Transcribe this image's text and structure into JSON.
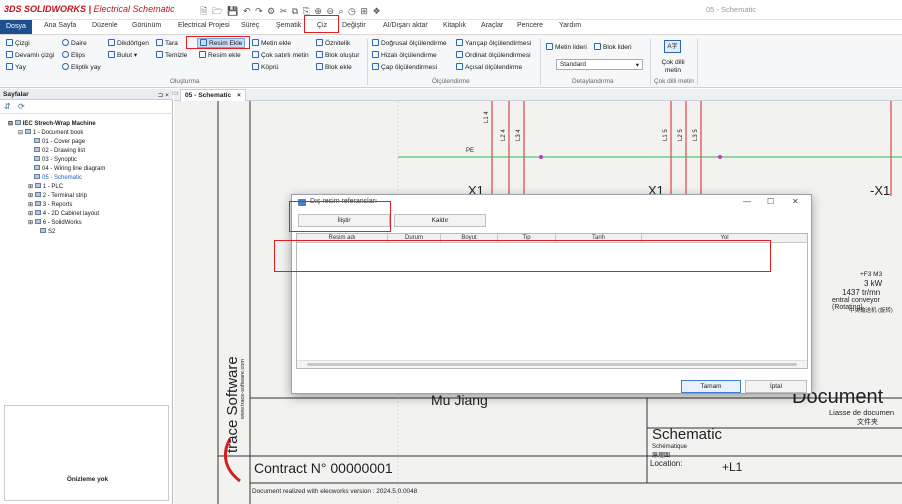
{
  "app": {
    "logo_brand": "3DS SOLIDWORKS",
    "logo_product": "Electrical Schematic",
    "quick_access": "🗎 🗁 💾 ↶ ↷ ⚙ ✂ ⧉ ⎘ ⊕ ⊖ ⌕ ◷ ⊞ ❖",
    "document_title": "05 - Schematic"
  },
  "tabs": [
    "Dosya",
    "Ana Sayfa",
    "Düzenle",
    "Görünüm",
    "Electrical Projesi",
    "Süreç",
    "Şematik",
    "Çiz",
    "Değiştir",
    "AI/Dışarı aktar",
    "Kitaplık",
    "Araçlar",
    "Pencere",
    "Yardım"
  ],
  "ribbon": {
    "col1": [
      "Çizgi",
      "Devamlı çizgi",
      "Yay"
    ],
    "col2": [
      "Daire",
      "Elips",
      "Eliptik yay"
    ],
    "col3": [
      "Dikdörtgen",
      "Bulut"
    ],
    "col4": [
      "Tara",
      "Temizle"
    ],
    "col5": [
      "Resim Ekle",
      "Resim ekle"
    ],
    "col6": [
      "Metin ekle",
      "Çok satırlı metin",
      "Köprü"
    ],
    "col7": [
      "Öznitelik",
      "Blok oluştur",
      "Blok ekle"
    ],
    "col8": [
      "Doğrusal ölçülendirme",
      "Hizalı ölçülendirme",
      "Çap ölçülendirmesi"
    ],
    "col9": [
      "Yarıçap ölçülendirmesi",
      "Ordinat ölçülendirmesi",
      "Açısal ölçülendirme"
    ],
    "col10": [
      "Metin lideri",
      "Blok lideri"
    ],
    "style_combo": "Standard",
    "multilang_label": "Çok dilli metin",
    "groups": {
      "olusturma": "Oluşturma",
      "olculendirme": "Ölçülendirme",
      "detaylandirma": "Detaylandırma",
      "cokdilli": "Çok dilli metin"
    }
  },
  "left_panel": {
    "title": "Sayfalar",
    "pin": "⊐ ×",
    "tree": [
      {
        "label": "IEC Strech-Wrap Machine",
        "level": 0,
        "bold": true
      },
      {
        "label": "1 - Document book",
        "level": 1
      },
      {
        "label": "01 - Cover page",
        "level": 2
      },
      {
        "label": "02 - Drawing list",
        "level": 2
      },
      {
        "label": "03 - Synoptic",
        "level": 2
      },
      {
        "label": "04 - Wiring line diagram",
        "level": 2
      },
      {
        "label": "05 - Schematic",
        "level": 2,
        "selected": true
      },
      {
        "label": "1 - PLC",
        "level": 1
      },
      {
        "label": "2 - Terminal strip",
        "level": 1
      },
      {
        "label": "3 - Reports",
        "level": 1
      },
      {
        "label": "4 - 2D Cabinet layout",
        "level": 1
      },
      {
        "label": "6 - SolidWorks",
        "level": 1
      },
      {
        "label": "S2",
        "level": 1
      }
    ],
    "preview_text": "Önizleme yok"
  },
  "doc_tab": {
    "label": "05 - Schematic",
    "close": "×"
  },
  "drawing": {
    "wire_labels": [
      "L1 4",
      "L2 4",
      "L3 4",
      "L1 5",
      "L2 5",
      "L3 5"
    ],
    "pe_label": "PE",
    "x1_left": "X1",
    "x1_mid": "X1",
    "x1_right": "-X1",
    "motor_tag": "+F3 M3",
    "motor_power": "3 kW",
    "motor_speed": "1437 tr/mn",
    "motor_desc": "entral conveyor (Rotating)",
    "motor_extra": "中央输送机 (旋转)",
    "vendor_side": "trace Software",
    "vendor_url": "www.trace-software.com",
    "engineer": "Mu Jiang",
    "doc_title_big": "Document",
    "doc_class": "Liasse de documen",
    "doc_class_cn": "文件夹",
    "schematic": "Schematic",
    "schematic_fr": "Schématique",
    "schematic_cn": "原理图",
    "location_label": "Location:",
    "location_value": "+L1",
    "contract": "Contract N°  00000001",
    "footer": "Document realized with elecworks version :   2024.5.0.0048"
  },
  "dialog": {
    "title": "Dış resim referansları",
    "add_button": "İliştir",
    "remove_button": "Kaldır",
    "columns": [
      "Resim adı",
      "Durum",
      "Boyut",
      "Tip",
      "Tarih",
      "Yol"
    ],
    "ok_button": "Tamam",
    "cancel_button": "İptal",
    "min": "—",
    "max": "☐",
    "close": "✕"
  }
}
